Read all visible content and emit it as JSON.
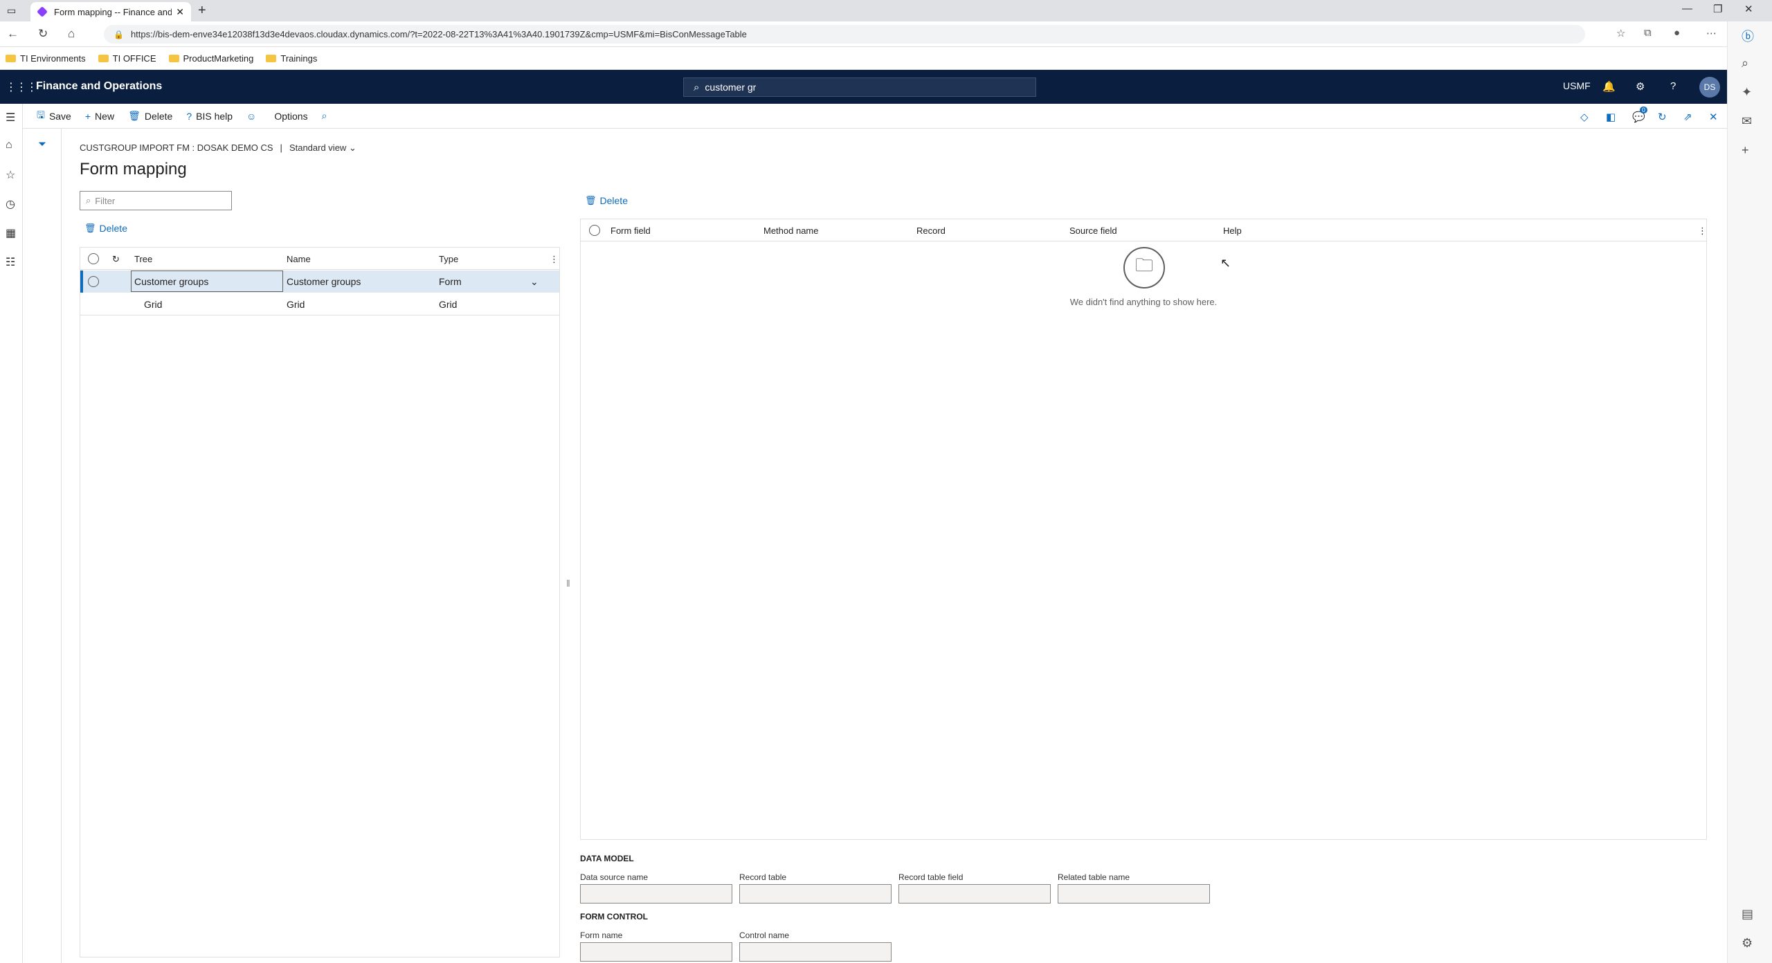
{
  "browser": {
    "tab_title": "Form mapping -- Finance and C",
    "url": "https://bis-dem-enve34e12038f13d3e4devaos.cloudax.dynamics.com/?t=2022-08-22T13%3A41%3A40.1901739Z&cmp=USMF&mi=BisConMessageTable",
    "favorites": [
      "TI Environments",
      "TI OFFICE",
      "ProductMarketing",
      "Trainings"
    ]
  },
  "app": {
    "name": "Finance and Operations",
    "search_value": "customer gr",
    "company": "USMF",
    "user_initials": "DS"
  },
  "actions": {
    "save": "Save",
    "new": "New",
    "delete": "Delete",
    "bis_help": "BIS help",
    "options": "Options",
    "notification_count": "0"
  },
  "page": {
    "breadcrumb": "CUSTGROUP IMPORT FM : DOSAK DEMO CS",
    "view": "Standard view",
    "title": "Form mapping",
    "filter_placeholder": "Filter"
  },
  "left_grid": {
    "delete_label": "Delete",
    "columns": [
      "Tree",
      "Name",
      "Type"
    ],
    "rows": [
      {
        "tree": "Customer groups",
        "name": "Customer groups",
        "type": "Form"
      },
      {
        "tree": "Grid",
        "name": "Grid",
        "type": "Grid"
      }
    ]
  },
  "right_grid": {
    "delete_label": "Delete",
    "columns": [
      "Form field",
      "Method name",
      "Record",
      "Source field",
      "Help"
    ],
    "empty_text": "We didn't find anything to show here."
  },
  "data_model": {
    "section": "DATA MODEL",
    "fields": [
      "Data source name",
      "Record table",
      "Record table field",
      "Related table name"
    ]
  },
  "form_control": {
    "section": "FORM CONTROL",
    "fields": [
      "Form name",
      "Control name"
    ]
  }
}
